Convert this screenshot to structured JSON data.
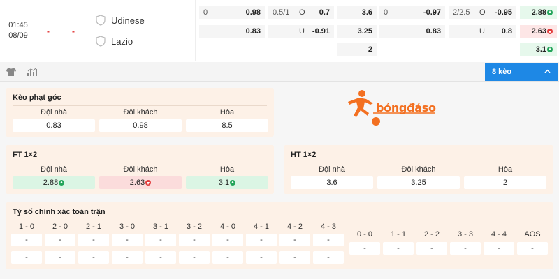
{
  "match": {
    "time": "01:45",
    "date": "08/09",
    "score_home": "-",
    "score_away": "-",
    "home_team": "Udinese",
    "away_team": "Lazio"
  },
  "odds_row1": [
    {
      "l": "0",
      "m": "",
      "r": "0.98"
    },
    {
      "l": "0.5/1",
      "m": "O",
      "r": "0.7"
    },
    {
      "l": "",
      "m": "",
      "r": "3.6"
    },
    {
      "l": "0",
      "m": "",
      "r": "-0.97"
    },
    {
      "l": "2/2.5",
      "m": "O",
      "r": "-0.95"
    },
    {
      "l": "",
      "m": "",
      "r": "2.88"
    }
  ],
  "odds_row2": [
    {
      "l": "",
      "m": "",
      "r": "0.83"
    },
    {
      "l": "",
      "m": "U",
      "r": "-0.91"
    },
    {
      "l": "",
      "m": "",
      "r": "3.25"
    },
    {
      "l": "",
      "m": "",
      "r": "0.83"
    },
    {
      "l": "",
      "m": "U",
      "r": "0.8"
    },
    {
      "l": "",
      "m": "",
      "r": "2.63"
    }
  ],
  "odds_row3": [
    {
      "r": "2"
    },
    {
      "r": "3.1"
    }
  ],
  "toolbar": {
    "keo_label": "8 kèo"
  },
  "corner": {
    "title": "Kèo phạt góc",
    "labels": [
      "Đội nhà",
      "Đội khách",
      "Hòa"
    ],
    "values": [
      "0.83",
      "0.98",
      "8.5"
    ]
  },
  "logo": {
    "text": "bóngđáso"
  },
  "ft": {
    "title": "FT 1×2",
    "labels": [
      "Đội nhà",
      "Đội khách",
      "Hòa"
    ],
    "values": [
      "2.88",
      "2.63",
      "3.1"
    ]
  },
  "ht": {
    "title": "HT 1×2",
    "labels": [
      "Đội nhà",
      "Đội khách",
      "Hòa"
    ],
    "values": [
      "3.6",
      "3.25",
      "2"
    ]
  },
  "correct_score": {
    "title": "Tỷ số chính xác toàn trận",
    "home_wins": [
      "1 - 0",
      "2 - 0",
      "2 - 1",
      "3 - 0",
      "3 - 1",
      "3 - 2",
      "4 - 0",
      "4 - 1",
      "4 - 2",
      "4 - 3"
    ],
    "draws": [
      "0 - 0",
      "1 - 1",
      "2 - 2",
      "3 - 3",
      "4 - 4",
      "AOS"
    ],
    "empty": "-"
  },
  "colors": {
    "accent": "#1e88e5",
    "up": "#23a55a",
    "down": "#e23b3b",
    "card": "#fdf1e7",
    "logo": "#f37021"
  }
}
